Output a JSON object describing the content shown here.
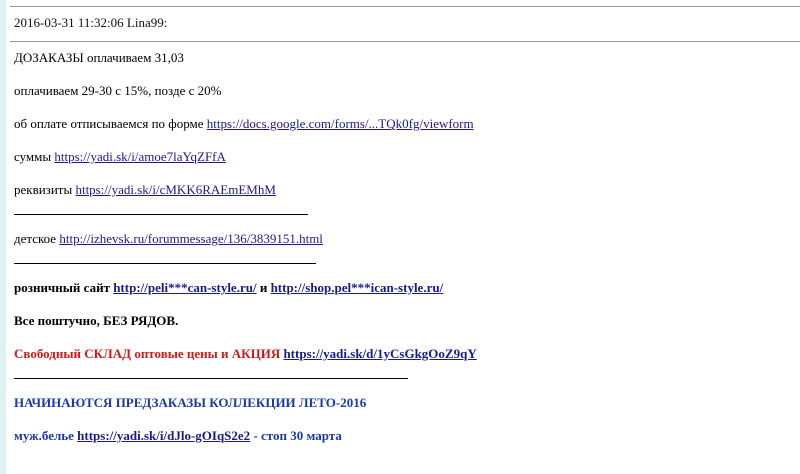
{
  "post": {
    "header": "2016-03-31 11:32:06 Lina99:",
    "lines": {
      "l1": "ДОЗАКАЗЫ оплачиваем 31,03",
      "l2": "оплачиваем 29-30 с 15%, позде с 20%",
      "l3_text": "об оплате отписываемся по форме ",
      "l3_link": "https://docs.google.com/forms/...TQk0fg/viewform",
      "l4_text": "суммы ",
      "l4_link": "https://yadi.sk/i/amoe7laYqZFfA",
      "l5_text": "реквизиты ",
      "l5_link": "https://yadi.sk/i/cMKK6RAEmEMhM",
      "l6_text": "детское ",
      "l6_link": "http://izhevsk.ru/forummessage/136/3839151.html",
      "l7_text": "розничный сайт ",
      "l7_link1": "http://peli***can-style.ru/",
      "l7_and": " и ",
      "l7_link2": "http://shop.pel***ican-style.ru/",
      "l8": "Все поштучно, БЕЗ РЯДОВ.",
      "l9_red": "Свободный СКЛАД оптовые цены и АКЦИЯ",
      "l9_link": "https://yadi.sk/d/1yCsGkgOoZ9qY",
      "l10": "НАЧИНАЮТСЯ ПРЕДЗАКАЗЫ КОЛЛЕКЦИИ ЛЕТО-2016",
      "l11_text": "муж.белье ",
      "l11_link": "https://yadi.sk/i/dJlo-gOIqS2e2",
      "l11_tail": " - стоп 30 марта"
    }
  },
  "colors": {
    "link": "#1a1a8c",
    "red_text": "#cc1a1a",
    "blue_text": "#1a38a6",
    "left_edge": "#dff1f1"
  }
}
